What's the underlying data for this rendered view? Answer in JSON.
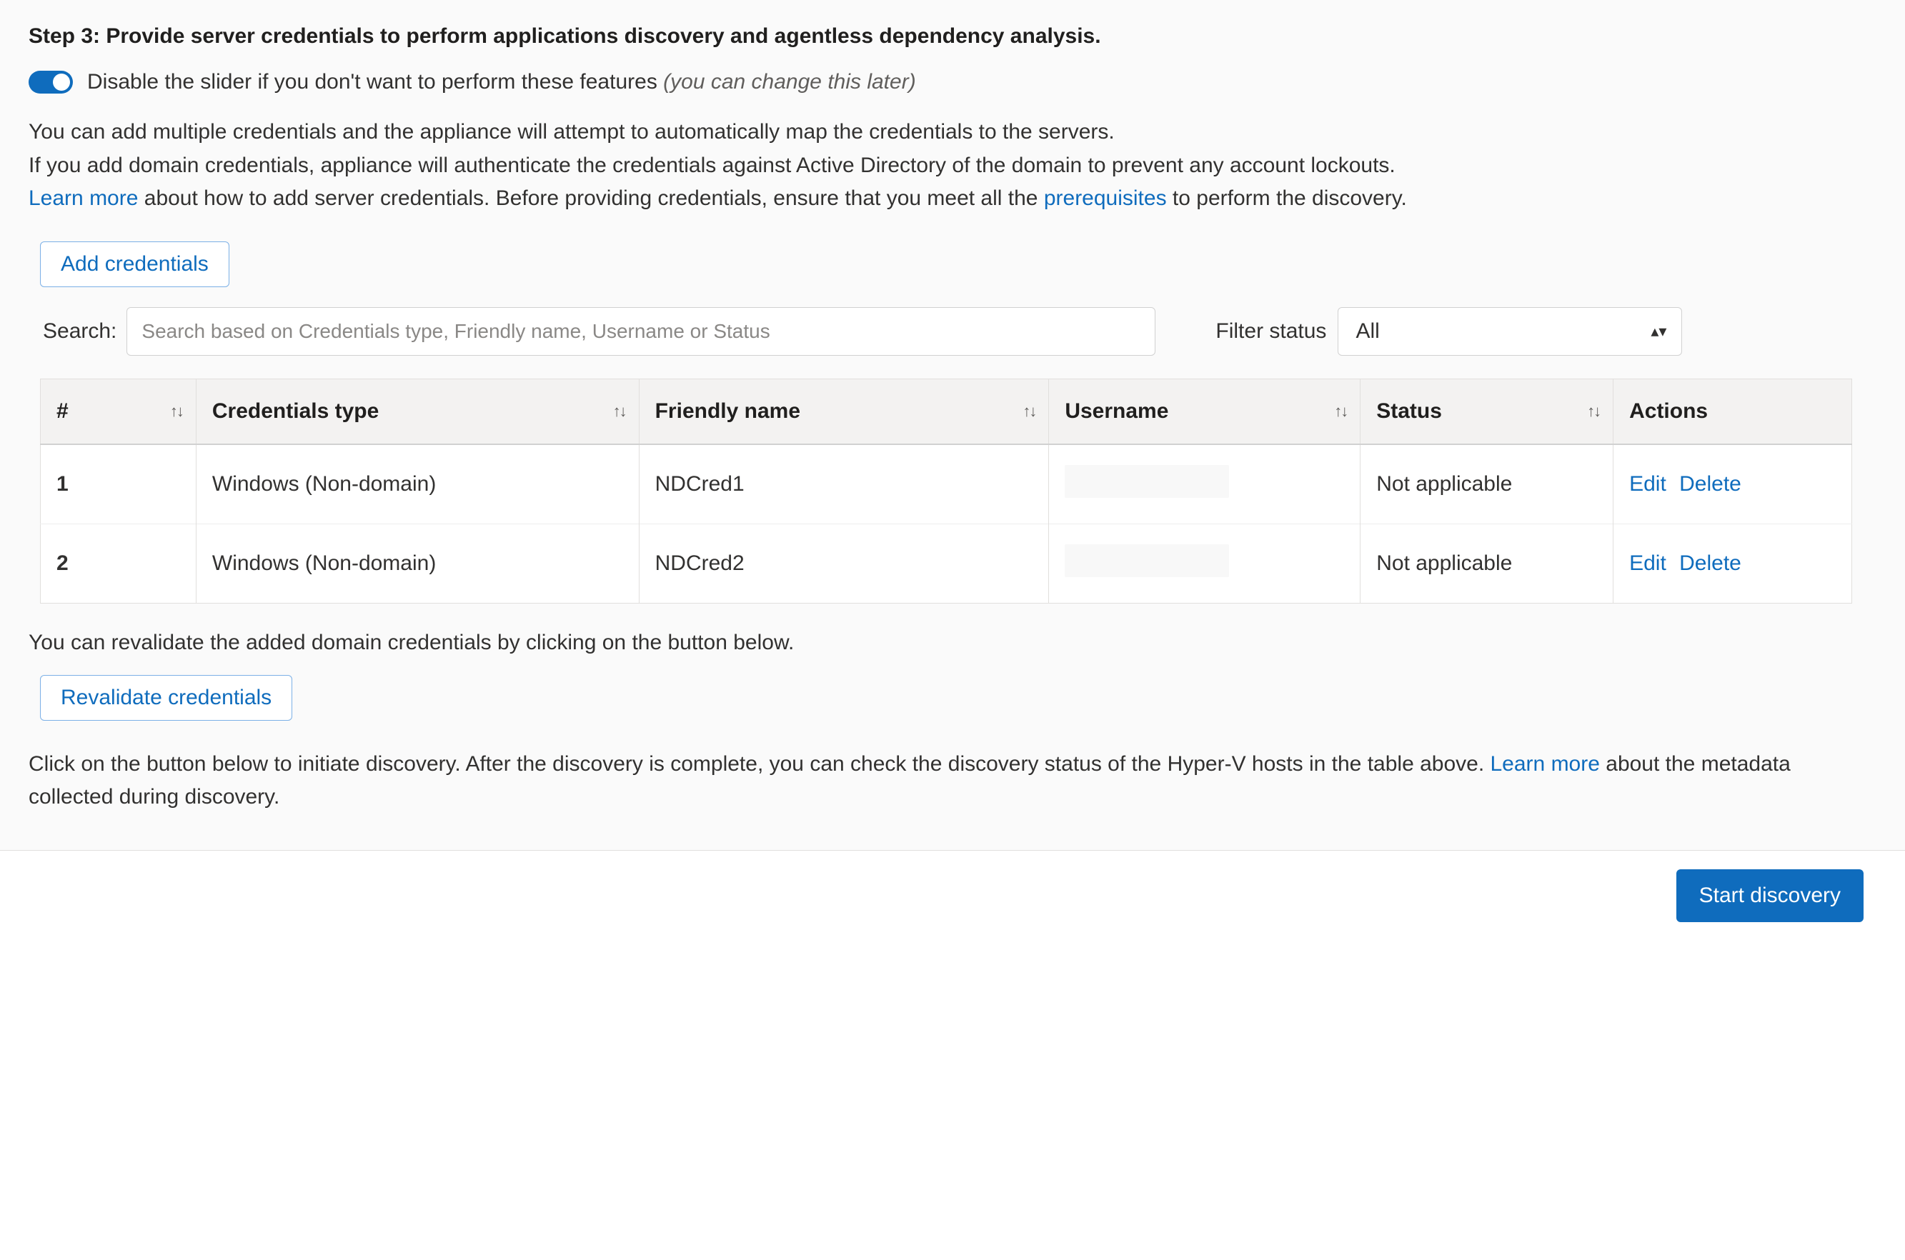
{
  "step": {
    "title": "Step 3: Provide server credentials to perform applications discovery and agentless dependency analysis."
  },
  "toggle": {
    "enabled": true,
    "label_prefix": "Disable the slider if you don't want to perform these features ",
    "label_italic": "(you can change this later)"
  },
  "description": {
    "line1": "You can add multiple credentials and the appliance will attempt to automatically map the credentials to the servers.",
    "line2": "If you add domain credentials, appliance will authenticate the credentials against Active Directory of the domain to prevent any account lockouts.",
    "line3_learn_more": "Learn more",
    "line3_mid": " about how to add server credentials. Before providing credentials, ensure that you meet all the ",
    "line3_prereq": "prerequisites",
    "line3_end": " to perform the discovery."
  },
  "add_credentials_button": "Add credentials",
  "search": {
    "label": "Search:",
    "placeholder": "Search based on Credentials type, Friendly name, Username or Status"
  },
  "filter": {
    "label": "Filter status",
    "selected": "All"
  },
  "table": {
    "headers": {
      "num": "#",
      "type": "Credentials type",
      "fname": "Friendly name",
      "user": "Username",
      "status": "Status",
      "actions": "Actions"
    },
    "rows": [
      {
        "num": "1",
        "type": "Windows (Non-domain)",
        "fname": "NDCred1",
        "user": "",
        "status": "Not applicable"
      },
      {
        "num": "2",
        "type": "Windows (Non-domain)",
        "fname": "NDCred2",
        "user": "",
        "status": "Not applicable"
      }
    ],
    "actions": {
      "edit": "Edit",
      "delete": "Delete"
    }
  },
  "revalidate": {
    "text": "You can revalidate the added domain credentials by clicking on the button below.",
    "button": "Revalidate credentials"
  },
  "final": {
    "text1": "Click on the button below to initiate discovery. After the discovery is complete, you can check the discovery status of the Hyper-V hosts in the table above. ",
    "learn_more": "Learn more",
    "text2": " about the metadata collected during discovery."
  },
  "start_button": "Start discovery"
}
